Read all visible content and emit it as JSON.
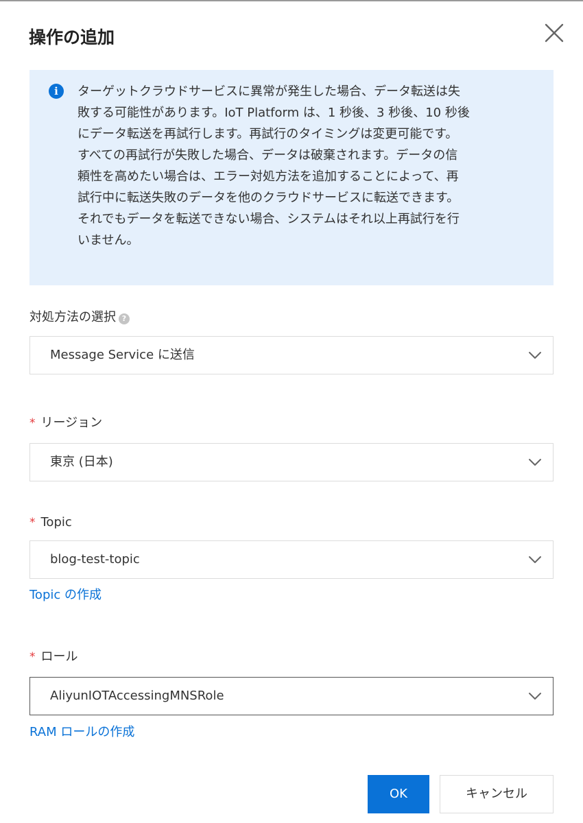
{
  "dialog": {
    "title": "操作の追加",
    "close_icon": "close-icon"
  },
  "info": {
    "icon": "info-icon",
    "icon_glyph": "i",
    "lines": [
      "ターゲットクラウドサービスに異常が発生した場合、データ転送は失",
      "敗する可能性があります。IoT Platform は、1 秒後、3 秒後、10 秒後",
      "にデータ転送を再試行します。再試行のタイミングは変更可能です。",
      "すべての再試行が失敗した場合、データは破棄されます。データの信",
      "頼性を高めたい場合は、エラー対処方法を追加することによって、再",
      "試行中に転送失敗のデータを他のクラウドサービスに転送できます。",
      "それでもデータを転送できない場合、システムはそれ以上再試行を行",
      "いません。"
    ]
  },
  "fields": {
    "method": {
      "label": "対処方法の選択",
      "help_glyph": "?",
      "value": "Message Service に送信"
    },
    "region": {
      "required_mark": "*",
      "label": "リージョン",
      "value": "東京 (日本)"
    },
    "topic": {
      "required_mark": "*",
      "label": "Topic",
      "value": "blog-test-topic",
      "create_link": "Topic の作成"
    },
    "role": {
      "required_mark": "*",
      "label": "ロール",
      "value": "AliyunIOTAccessingMNSRole",
      "create_link": "RAM ロールの作成"
    }
  },
  "buttons": {
    "ok": "OK",
    "cancel": "キャンセル"
  },
  "colors": {
    "accent": "#0a72d7",
    "info_bg": "#e5f0fc",
    "required": "#e4393c"
  }
}
